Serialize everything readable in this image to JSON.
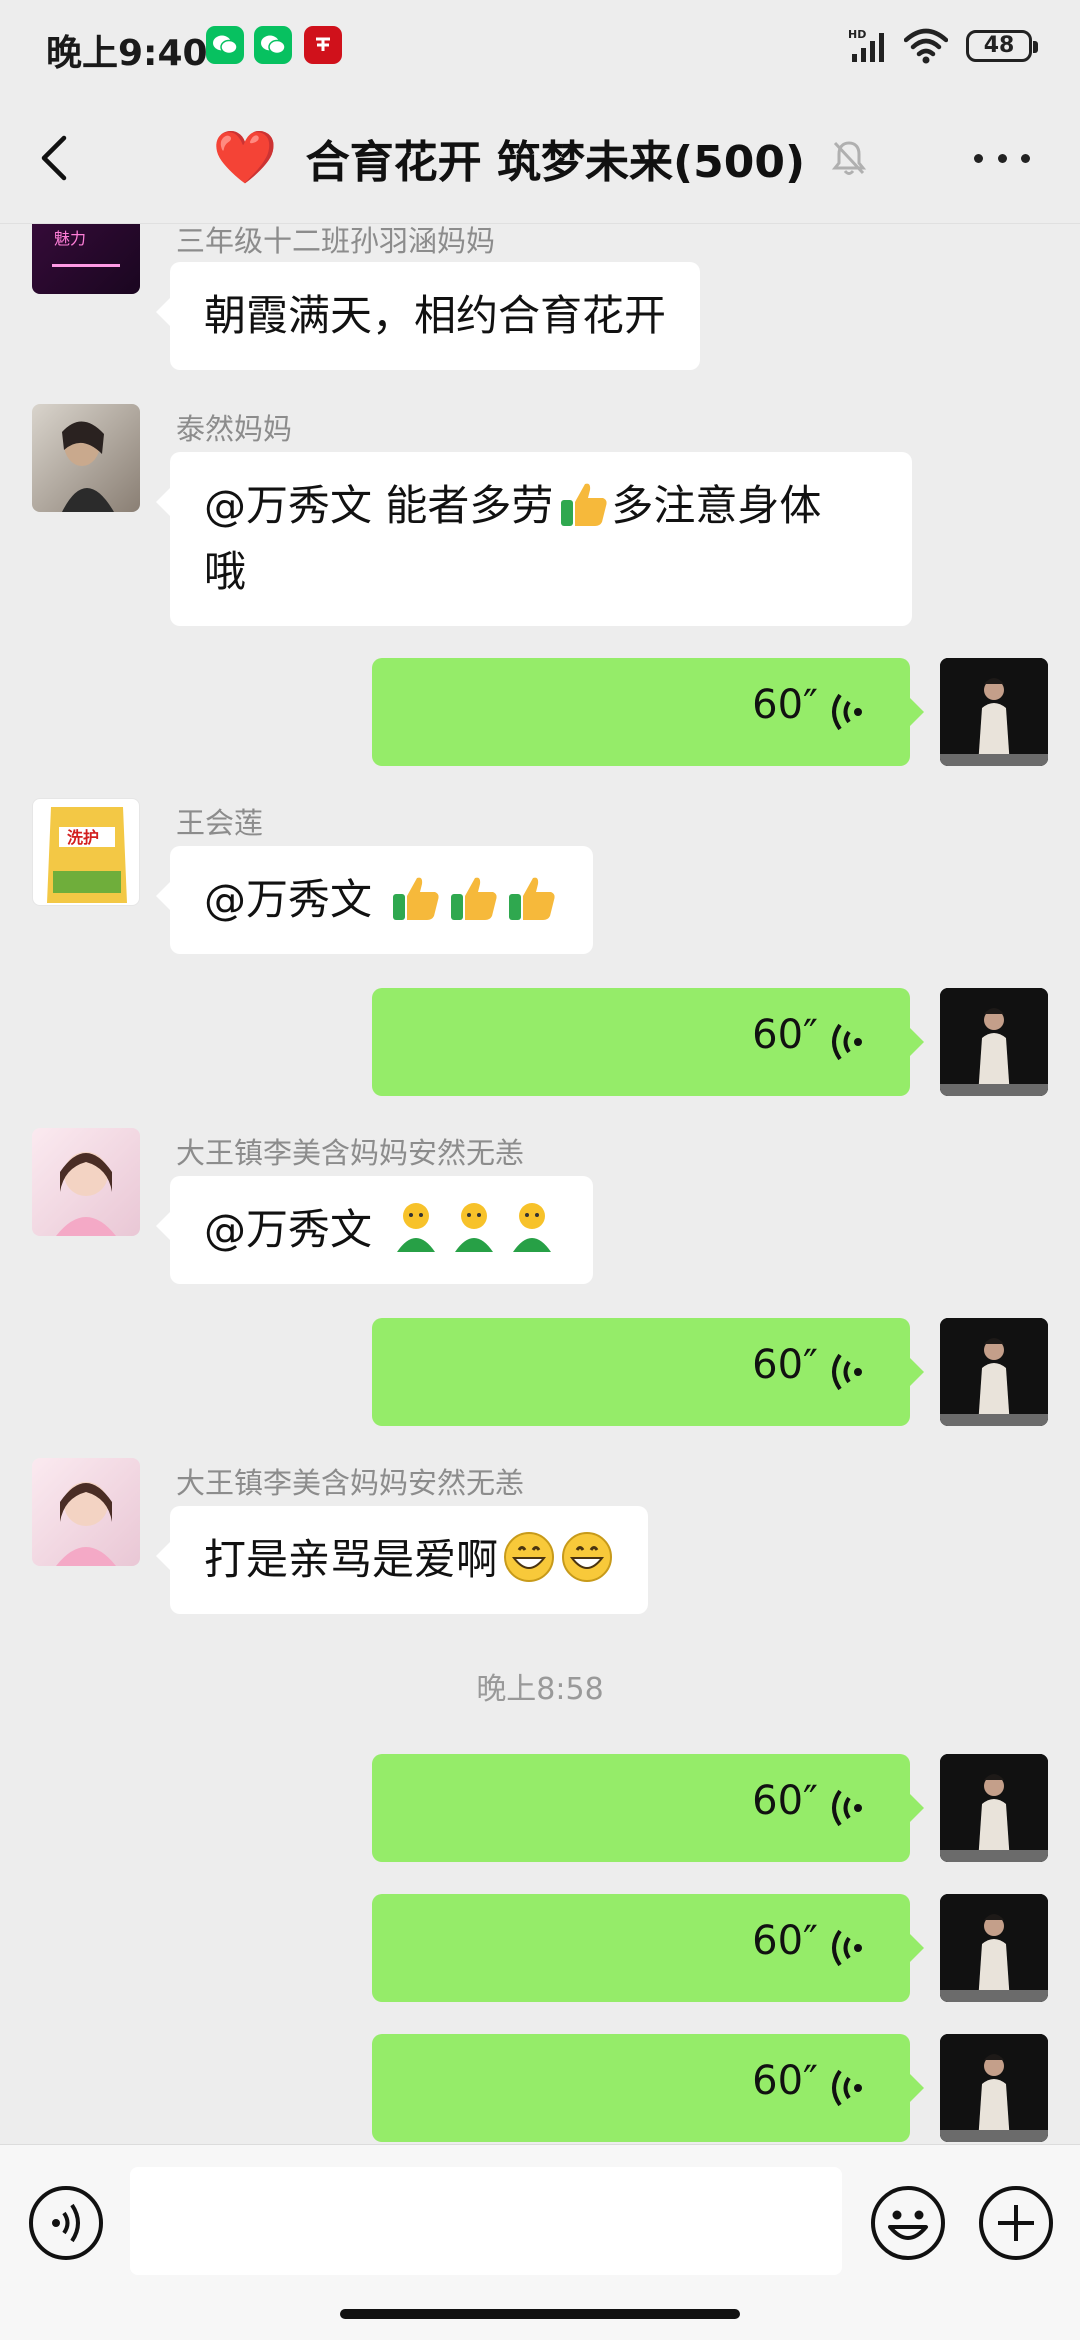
{
  "status_bar": {
    "time": "晚上9:40",
    "battery": "48",
    "network": "HD"
  },
  "header": {
    "title": "合育花开 筑梦未来(500)",
    "title_emoji": "❤️"
  },
  "messages": [
    {
      "type": "incoming",
      "sender": "三年级十二班孙羽涵妈妈",
      "text": "朝霞满天，相约合育花开"
    },
    {
      "type": "incoming",
      "sender": "泰然妈妈",
      "text": "@万秀文  能者多劳",
      "text_after_emoji": "多注意身体",
      "text_line2": "哦"
    },
    {
      "type": "voice",
      "duration": "60″"
    },
    {
      "type": "incoming",
      "sender": "王会莲",
      "text": "@万秀文 "
    },
    {
      "type": "voice",
      "duration": "60″"
    },
    {
      "type": "incoming",
      "sender": "大王镇李美含妈妈安然无恙",
      "text": "@万秀文 "
    },
    {
      "type": "voice",
      "duration": "60″"
    },
    {
      "type": "incoming",
      "sender": "大王镇李美含妈妈安然无恙",
      "text": "打是亲骂是爱啊"
    },
    {
      "type": "timestamp",
      "text": "晚上8:58"
    },
    {
      "type": "voice",
      "duration": "60″"
    },
    {
      "type": "voice",
      "duration": "60″"
    },
    {
      "type": "voice",
      "duration": "60″"
    }
  ],
  "colors": {
    "background": "#EDEDED",
    "bubble_out": "#95EC69",
    "bubble_in": "#FFFFFF"
  }
}
